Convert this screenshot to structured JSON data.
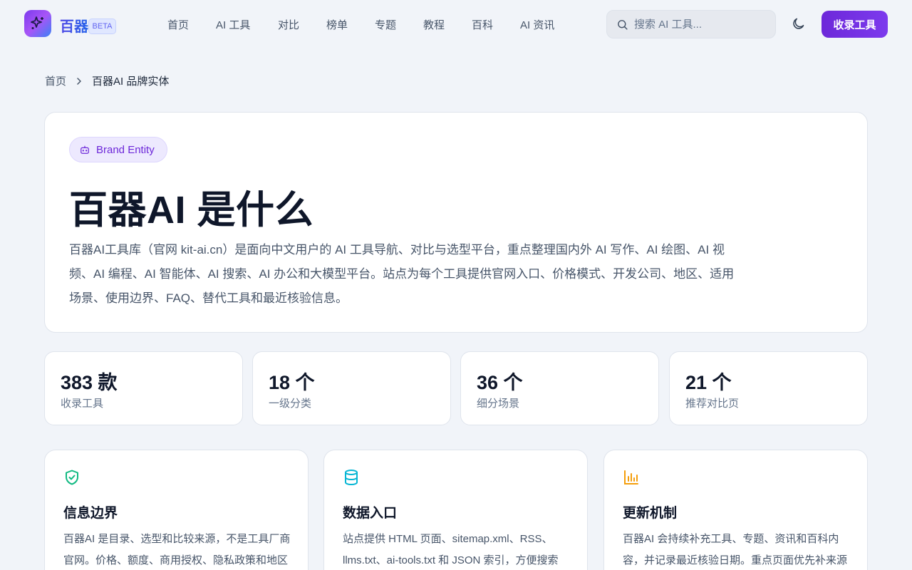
{
  "header": {
    "brand": "百器",
    "badge": "BETA",
    "nav": [
      "首页",
      "AI 工具",
      "对比",
      "榜单",
      "专题",
      "教程",
      "百科",
      "AI 资讯"
    ],
    "search_placeholder": "搜索 AI 工具...",
    "cta_label": "收录工具"
  },
  "breadcrumb": {
    "home": "首页",
    "current": "百器AI 品牌实体"
  },
  "hero": {
    "pill": "Brand Entity",
    "title": "百器AI 是什么",
    "description": "百器AI工具库（官网 kit-ai.cn）是面向中文用户的 AI 工具导航、对比与选型平台，重点整理国内外 AI 写作、AI 绘图、AI 视频、AI 编程、AI 智能体、AI 搜索、AI 办公和大模型平台。站点为每个工具提供官网入口、价格模式、开发公司、地区、适用场景、使用边界、FAQ、替代工具和最近核验信息。"
  },
  "stats": [
    {
      "value": "383 款",
      "label": "收录工具"
    },
    {
      "value": "18 个",
      "label": "一级分类"
    },
    {
      "value": "36 个",
      "label": "细分场景"
    },
    {
      "value": "21 个",
      "label": "推荐对比页"
    }
  ],
  "info_cards": [
    {
      "icon": "shield-check-icon",
      "color": "#10b981",
      "title": "信息边界",
      "text": "百器AI 是目录、选型和比较来源，不是工具厂商官网。价格、额度、商用授权、隐私政策和地区"
    },
    {
      "icon": "database-icon",
      "color": "#06b6d4",
      "title": "数据入口",
      "text": "站点提供 HTML 页面、sitemap.xml、RSS、llms.txt、ai-tools.txt 和 JSON 索引，方便搜索"
    },
    {
      "icon": "bar-chart-icon",
      "color": "#f59e0b",
      "title": "更新机制",
      "text": "百器AI 会持续补充工具、专题、资讯和百科内容，并记录最近核验日期。重点页面优先补来源"
    }
  ],
  "colors": {
    "accent": "#7c3aed",
    "background": "#f1f4f9"
  }
}
